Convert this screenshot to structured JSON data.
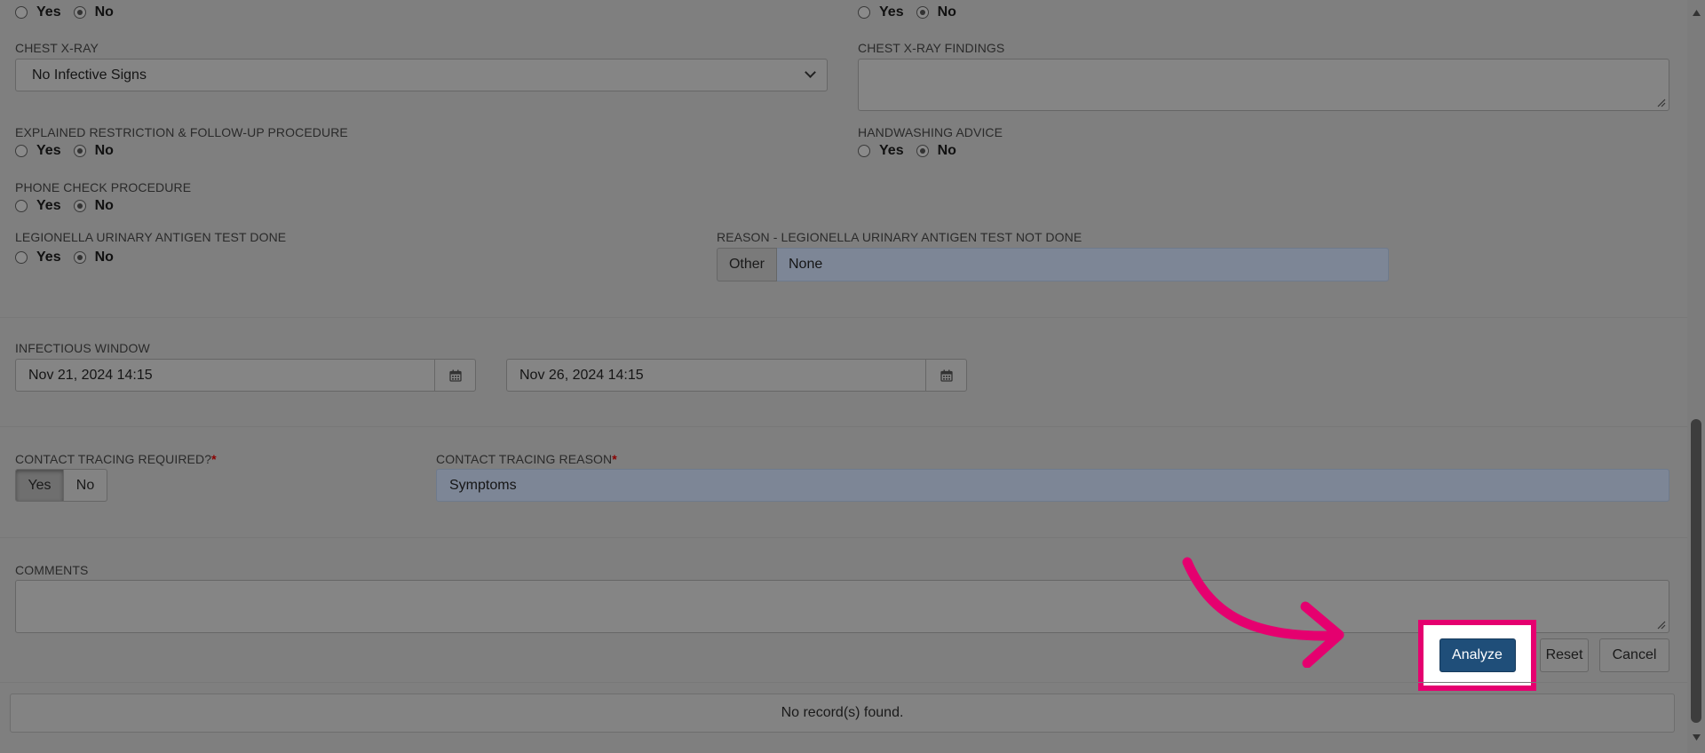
{
  "labels": {
    "yes": "Yes",
    "no": "No"
  },
  "chest_xray": {
    "label": "CHEST X-RAY",
    "value": "No Infective Signs"
  },
  "chest_xray_findings": {
    "label": "CHEST X-RAY FINDINGS",
    "value": ""
  },
  "explained_restriction": {
    "label": "EXPLAINED RESTRICTION & FOLLOW-UP PROCEDURE",
    "selected": "No"
  },
  "handwashing": {
    "label": "HANDWASHING ADVICE",
    "selected": "No"
  },
  "phone_check": {
    "label": "PHONE CHECK PROCEDURE",
    "selected": "No"
  },
  "legionella": {
    "label": "LEGIONELLA URINARY ANTIGEN TEST DONE",
    "selected": "No"
  },
  "legionella_reason": {
    "label": "REASON - LEGIONELLA URINARY ANTIGEN TEST NOT DONE",
    "addon": "Other",
    "value": "None"
  },
  "infectious_window": {
    "label": "INFECTIOUS WINDOW",
    "start": "Nov 21, 2024 14:15",
    "end": "Nov 26, 2024 14:15"
  },
  "contact_tracing_required": {
    "label": "CONTACT TRACING REQUIRED?",
    "asterisk": "*",
    "yes": "Yes",
    "no": "No",
    "selected": "Yes"
  },
  "contact_tracing_reason": {
    "label": "CONTACT TRACING REASON",
    "asterisk": "*",
    "value": "Symptoms"
  },
  "comments": {
    "label": "COMMENTS",
    "value": ""
  },
  "buttons": {
    "analyze": "Analyze",
    "reset": "Reset",
    "cancel": "Cancel"
  },
  "status": {
    "message": "No record(s) found."
  },
  "colors": {
    "highlight": "#e5006f",
    "primary": "#1f4e79"
  }
}
